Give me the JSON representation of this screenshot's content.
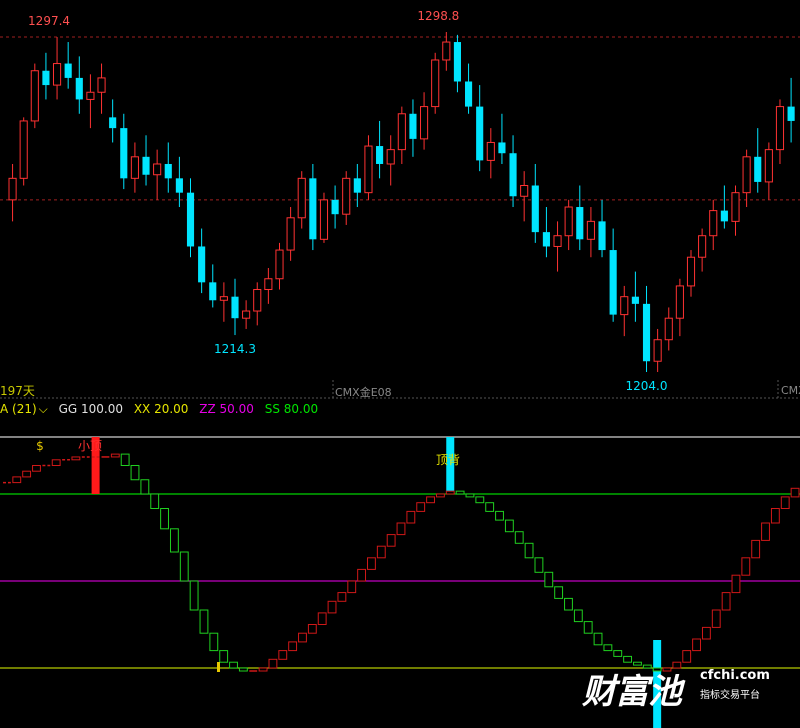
{
  "upper_panel": {
    "days_label": "197天",
    "symbol_label_1": "CMX金E08",
    "symbol_label_2": "CMX"
  },
  "indicator_header": {
    "name": "A (21)",
    "dropdown_icon": "chevron-down-icon",
    "params": [
      {
        "label": "GG 100.00",
        "color": "#e0e0e0"
      },
      {
        "label": "XX 20.00",
        "color": "#e6e600"
      },
      {
        "label": "ZZ 50.00",
        "color": "#e600e6"
      },
      {
        "label": "SS 80.00",
        "color": "#00e600"
      }
    ]
  },
  "annotations": {
    "dollar_sign": "$",
    "small_top": "小顶",
    "top_divergence": "顶背"
  },
  "watermark": {
    "brand_cn": "财富池",
    "url": "cfchi.com",
    "tagline": "指标交易平台"
  },
  "colors": {
    "up": "#ff3232",
    "down": "#00e5ff",
    "dashed": "#a02020",
    "osc_up": "#d01818",
    "osc_down": "#20d020",
    "line_100": "#d0d0d0",
    "line_80": "#00d000",
    "line_50": "#c000c0",
    "line_20": "#b4c800"
  },
  "chart_data": [
    {
      "type": "candlestick",
      "y_levels_dashed": [
        1297.4,
        1252.0
      ],
      "annotations": [
        {
          "text": "1297.4",
          "kind": "high"
        },
        {
          "text": "1298.8",
          "kind": "high"
        },
        {
          "text": "1214.3",
          "kind": "low"
        },
        {
          "text": "1204.0",
          "kind": "low"
        }
      ],
      "ohlc": [
        [
          1252,
          1262,
          1246,
          1258
        ],
        [
          1258,
          1275,
          1256,
          1274
        ],
        [
          1274,
          1290,
          1272,
          1288
        ],
        [
          1288,
          1293,
          1280,
          1284
        ],
        [
          1284,
          1297.4,
          1280,
          1290
        ],
        [
          1290,
          1296,
          1283,
          1286
        ],
        [
          1286,
          1292,
          1276,
          1280
        ],
        [
          1280,
          1287,
          1272,
          1282
        ],
        [
          1282,
          1290,
          1276,
          1286
        ],
        [
          1275,
          1280,
          1268,
          1272
        ],
        [
          1272,
          1276,
          1255,
          1258
        ],
        [
          1258,
          1268,
          1254,
          1264
        ],
        [
          1264,
          1270,
          1256,
          1259
        ],
        [
          1259,
          1266,
          1252,
          1262
        ],
        [
          1262,
          1268,
          1254,
          1258
        ],
        [
          1258,
          1264,
          1250,
          1254
        ],
        [
          1254,
          1258,
          1236,
          1239
        ],
        [
          1239,
          1244,
          1226,
          1229
        ],
        [
          1229,
          1234,
          1222,
          1224
        ],
        [
          1224,
          1229,
          1218,
          1225
        ],
        [
          1225,
          1230,
          1214.3,
          1219
        ],
        [
          1219,
          1224,
          1216,
          1221
        ],
        [
          1221,
          1229,
          1217,
          1227
        ],
        [
          1227,
          1233,
          1223,
          1230
        ],
        [
          1230,
          1240,
          1227,
          1238
        ],
        [
          1238,
          1250,
          1235,
          1247
        ],
        [
          1247,
          1260,
          1244,
          1258
        ],
        [
          1258,
          1262,
          1238,
          1241
        ],
        [
          1241,
          1254,
          1240,
          1252
        ],
        [
          1252,
          1256,
          1244,
          1248
        ],
        [
          1248,
          1260,
          1245,
          1258
        ],
        [
          1258,
          1262,
          1250,
          1254
        ],
        [
          1254,
          1270,
          1252,
          1267
        ],
        [
          1267,
          1274,
          1258,
          1262
        ],
        [
          1262,
          1270,
          1256,
          1266
        ],
        [
          1266,
          1278,
          1262,
          1276
        ],
        [
          1276,
          1280,
          1264,
          1269
        ],
        [
          1269,
          1282,
          1266,
          1278
        ],
        [
          1278,
          1293,
          1276,
          1291
        ],
        [
          1291,
          1298.8,
          1288,
          1296
        ],
        [
          1296,
          1298,
          1282,
          1285
        ],
        [
          1285,
          1290,
          1276,
          1278
        ],
        [
          1278,
          1284,
          1260,
          1263
        ],
        [
          1263,
          1272,
          1258,
          1268
        ],
        [
          1268,
          1276,
          1262,
          1265
        ],
        [
          1265,
          1270,
          1250,
          1253
        ],
        [
          1253,
          1260,
          1246,
          1256
        ],
        [
          1256,
          1262,
          1240,
          1243
        ],
        [
          1243,
          1250,
          1236,
          1239
        ],
        [
          1239,
          1246,
          1232,
          1242
        ],
        [
          1242,
          1252,
          1238,
          1250
        ],
        [
          1250,
          1256,
          1238,
          1241
        ],
        [
          1241,
          1250,
          1236,
          1246
        ],
        [
          1246,
          1252,
          1236,
          1238
        ],
        [
          1238,
          1244,
          1218,
          1220
        ],
        [
          1220,
          1228,
          1214,
          1225
        ],
        [
          1225,
          1232,
          1218,
          1223
        ],
        [
          1223,
          1228,
          1204,
          1207
        ],
        [
          1207,
          1216,
          1204,
          1213
        ],
        [
          1213,
          1222,
          1210,
          1219
        ],
        [
          1219,
          1230,
          1214,
          1228
        ],
        [
          1228,
          1238,
          1225,
          1236
        ],
        [
          1236,
          1244,
          1232,
          1242
        ],
        [
          1242,
          1252,
          1238,
          1249
        ],
        [
          1249,
          1256,
          1244,
          1246
        ],
        [
          1246,
          1256,
          1242,
          1254
        ],
        [
          1254,
          1266,
          1250,
          1264
        ],
        [
          1264,
          1272,
          1254,
          1257
        ],
        [
          1257,
          1268,
          1252,
          1266
        ],
        [
          1266,
          1280,
          1262,
          1278
        ],
        [
          1278,
          1286,
          1268,
          1274
        ]
      ]
    },
    {
      "type": "oscillator",
      "ylim": [
        0,
        100
      ],
      "reference_lines": [
        100,
        80,
        50,
        20
      ],
      "values": [
        84,
        86,
        88,
        90,
        90,
        92,
        92,
        93,
        93,
        93,
        93,
        94,
        90,
        85,
        80,
        75,
        68,
        60,
        50,
        40,
        32,
        26,
        22,
        20,
        19,
        19,
        20,
        23,
        26,
        29,
        32,
        35,
        39,
        43,
        46,
        50,
        54,
        58,
        62,
        66,
        70,
        74,
        77,
        79,
        80,
        81,
        80,
        79,
        77,
        74,
        71,
        67,
        63,
        58,
        53,
        48,
        44,
        40,
        36,
        32,
        28,
        26,
        24,
        22,
        21,
        20,
        19,
        20,
        22,
        26,
        30,
        34,
        40,
        46,
        52,
        58,
        64,
        70,
        75,
        79,
        82
      ],
      "bars": [
        {
          "index": 9,
          "kind": "sell",
          "label": "小顶"
        },
        {
          "index": 45,
          "kind": "top-divergence",
          "label": "顶背"
        },
        {
          "index": 66,
          "kind": "buy"
        }
      ]
    }
  ]
}
